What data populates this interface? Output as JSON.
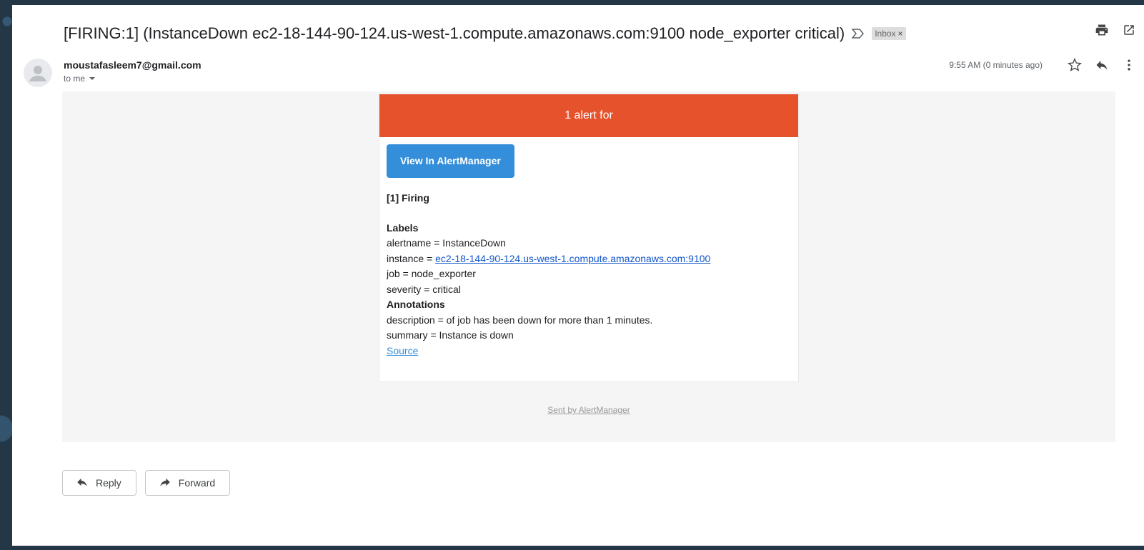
{
  "email": {
    "subject": "[FIRING:1] (InstanceDown ec2-18-144-90-124.us-west-1.compute.amazonaws.com:9100 node_exporter critical)",
    "label_chip": "Inbox",
    "label_chip_close": "×",
    "sender": "moustafasleem7@gmail.com",
    "to": "to me",
    "time": "9:55 AM (0 minutes ago)"
  },
  "alert": {
    "header": "1 alert for",
    "view_button": "View In AlertManager",
    "firing": "[1] Firing",
    "labels_heading": "Labels",
    "alertname_line": "alertname = InstanceDown",
    "instance_prefix": "instance = ",
    "instance_link": "ec2-18-144-90-124.us-west-1.compute.amazonaws.com:9100",
    "job_line": "job = node_exporter",
    "severity_line": "severity = critical",
    "annotations_heading": "Annotations",
    "description_line": "description = of job has been down for more than 1 minutes.",
    "summary_line": "summary = Instance is down",
    "source_link": "Source"
  },
  "footer": {
    "sent_by": "Sent by AlertManager"
  },
  "actions": {
    "reply": "Reply",
    "forward": "Forward"
  },
  "colors": {
    "alert_header": "#e6522c",
    "button": "#348eda",
    "link": "#1155cc"
  },
  "icons": [
    "label-important-icon",
    "print-icon",
    "open-in-new-window-icon",
    "star-icon",
    "reply-icon",
    "more-vert-icon",
    "avatar-icon",
    "reply-icon",
    "forward-icon"
  ]
}
